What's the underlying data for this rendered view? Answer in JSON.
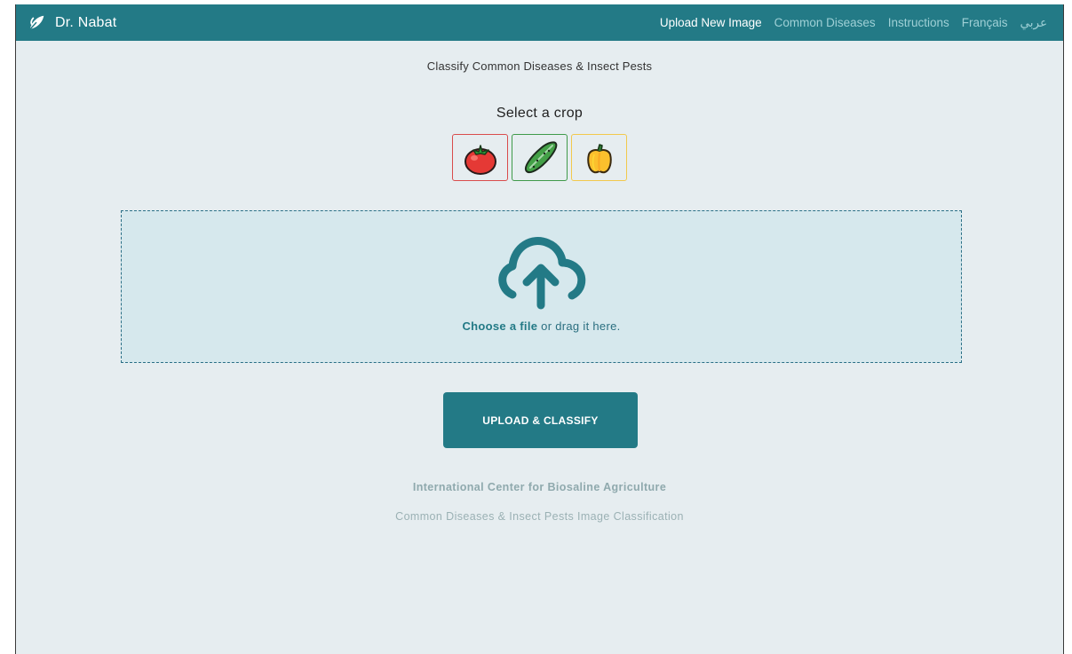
{
  "app": {
    "brand": "Dr. Nabat",
    "accent_color": "#237a86"
  },
  "nav": {
    "items": [
      {
        "label": "Upload New Image",
        "active": true
      },
      {
        "label": "Common Diseases",
        "active": false
      },
      {
        "label": "Instructions",
        "active": false
      },
      {
        "label": "Français",
        "active": false
      },
      {
        "label": "عربي",
        "active": false
      }
    ]
  },
  "main": {
    "subtitle": "Classify Common Diseases & Insect Pests",
    "select_crop_label": "Select a crop",
    "crops": [
      {
        "name": "tomato",
        "icon": "tomato-icon",
        "border_color": "#d94c4c"
      },
      {
        "name": "cucumber",
        "icon": "cucumber-icon",
        "border_color": "#3f9a4a"
      },
      {
        "name": "pepper",
        "icon": "bell-pepper-icon",
        "border_color": "#f2c94c"
      }
    ],
    "dropzone": {
      "icon": "cloud-upload-icon",
      "choose_label": "Choose a file",
      "drag_label": " or drag it here."
    },
    "classify_button": "UPLOAD & CLASSIFY"
  },
  "footer": {
    "org": "International Center for Biosaline Agriculture",
    "description": "Common Diseases & Insect Pests Image Classification"
  }
}
